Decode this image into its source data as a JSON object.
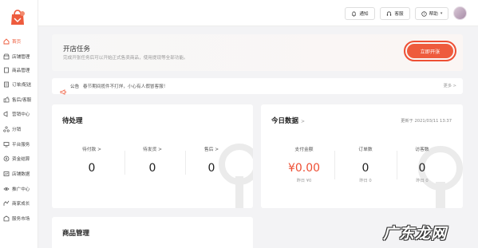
{
  "sidebar": {
    "items": [
      {
        "label": "首页",
        "icon": "home-icon",
        "active": true
      },
      {
        "label": "店铺管理",
        "icon": "shop-icon"
      },
      {
        "label": "商品管理",
        "icon": "goods-icon"
      },
      {
        "label": "订单/配送",
        "icon": "order-icon"
      },
      {
        "label": "售后/客服",
        "icon": "service-icon"
      },
      {
        "label": "营销中心",
        "icon": "marketing-icon"
      },
      {
        "label": "分销",
        "icon": "distribution-icon"
      },
      {
        "label": "平台服务",
        "icon": "platform-icon"
      },
      {
        "label": "资金结算",
        "icon": "fund-icon"
      },
      {
        "label": "店铺数据",
        "icon": "data-icon"
      },
      {
        "label": "推广中心",
        "icon": "promote-icon"
      },
      {
        "label": "商家成长",
        "icon": "growth-icon"
      },
      {
        "label": "服务市场",
        "icon": "market-icon"
      }
    ]
  },
  "topbar": {
    "notify_label": "通知",
    "support_label": "客服",
    "help_label": "帮助"
  },
  "open_store": {
    "title": "开店任务",
    "subtitle": "完成开张任务后可以开始正式售卖商品，使用提现等全部功能。",
    "button_label": "立即开张"
  },
  "notice": {
    "tag": "公告",
    "text": "春节期间揽件不打烊，小心有人假冒客服！",
    "more": "更多 >"
  },
  "pending": {
    "title": "待处理",
    "metrics": [
      {
        "label": "待付款 >",
        "value": "0"
      },
      {
        "label": "待发货 >",
        "value": "0"
      },
      {
        "label": "售后 >",
        "value": "0"
      }
    ]
  },
  "today": {
    "title": "今日数据",
    "updated": "更新于 2021/03/11 13:37",
    "metrics": [
      {
        "label": "支付金额",
        "value": "¥0.00",
        "sub": "昨日 ¥0"
      },
      {
        "label": "订单数",
        "value": "0",
        "sub": "昨日 0"
      },
      {
        "label": "访客数",
        "value": "0",
        "sub": "昨日 0"
      }
    ]
  },
  "goods": {
    "title": "商品管理"
  },
  "watermark": "广东龙网",
  "colors": {
    "accent": "#ee5b3d",
    "background": "#f3f3f5"
  }
}
